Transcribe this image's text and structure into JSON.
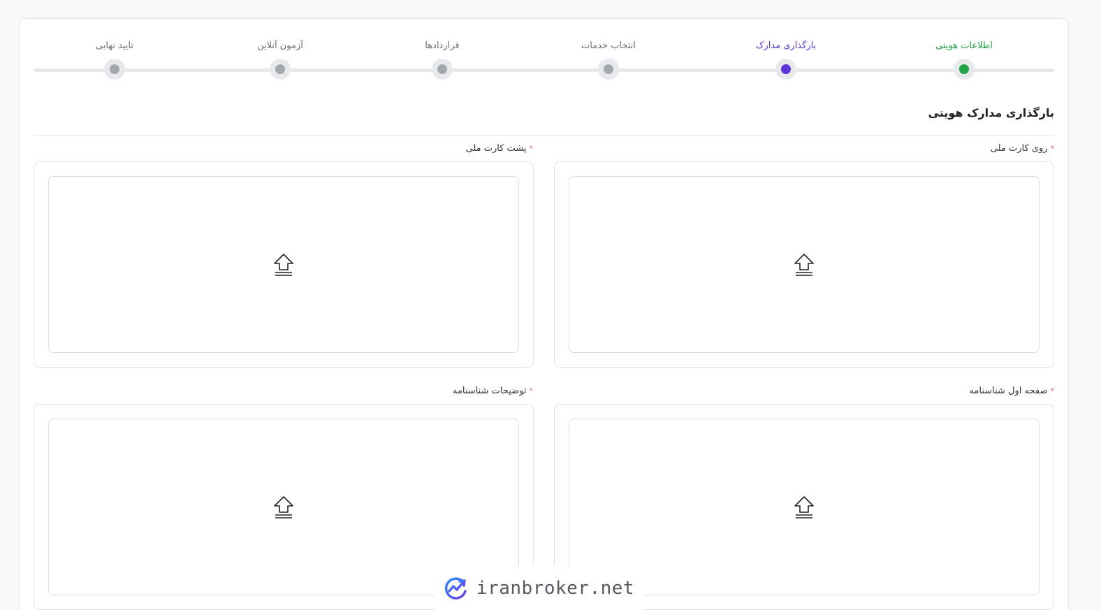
{
  "stepper": {
    "steps": [
      {
        "label": "اطلاعات هویتی",
        "state": "done"
      },
      {
        "label": "بارگذاری مدارک",
        "state": "active"
      },
      {
        "label": "انتخاب خدمات",
        "state": "pending"
      },
      {
        "label": "قراردادها",
        "state": "pending"
      },
      {
        "label": "آزمون آنلاین",
        "state": "pending"
      },
      {
        "label": "تایید نهایی",
        "state": "pending"
      }
    ]
  },
  "section": {
    "title": "بارگذاری مدارک هویتی"
  },
  "uploads": {
    "national_card_front": {
      "label": "روی کارت ملی",
      "required_mark": "*"
    },
    "national_card_back": {
      "label": "پشت کارت ملی",
      "required_mark": "*"
    },
    "birth_cert_first_page": {
      "label": "صفحه اول شناسنامه",
      "required_mark": "*"
    },
    "birth_cert_notes": {
      "label": "توضیحات شناسنامه",
      "required_mark": "*"
    }
  },
  "watermark": {
    "text": "iranbroker.net"
  },
  "colors": {
    "done": "#22a447",
    "active": "#5b35d5",
    "pending": "#a3a8ae",
    "required": "#e8677d"
  },
  "icons": {
    "upload": "upload-arrow-icon",
    "logo": "chart-logo-icon"
  }
}
